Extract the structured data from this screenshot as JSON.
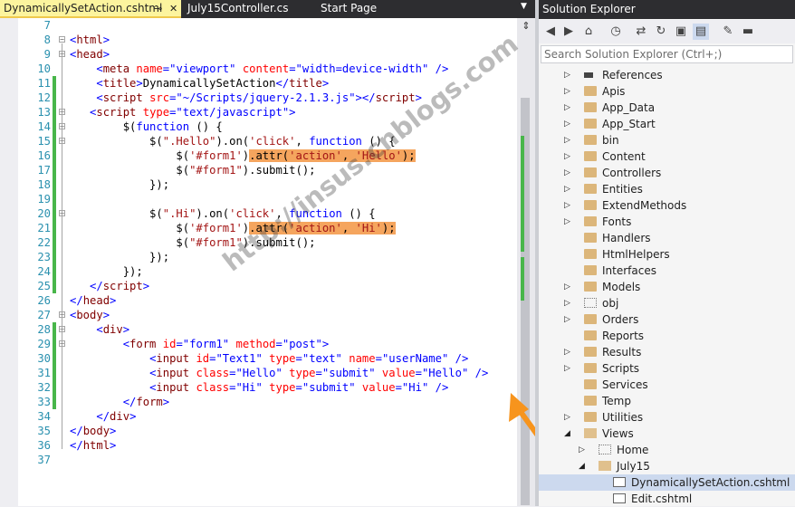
{
  "tabs": [
    {
      "label": "DynamicallySetAction.cshtml",
      "active": true
    },
    {
      "label": "July15Controller.cs",
      "active": false
    },
    {
      "label": "Start Page",
      "active": false
    }
  ],
  "icons": {
    "pin": "pin-icon",
    "close": "close-icon",
    "dropdown": "dropdown-icon"
  },
  "code_lines": [
    {
      "n": "7",
      "fold": "",
      "changed": false,
      "html": ""
    },
    {
      "n": "8",
      "fold": "minus",
      "changed": false,
      "html": "<span class='v'>&lt;</span><span class='t'>html</span><span class='v'>&gt;</span>"
    },
    {
      "n": "9",
      "fold": "minus",
      "changed": false,
      "html": "<span class='v'>&lt;</span><span class='t'>head</span><span class='v'>&gt;</span>"
    },
    {
      "n": "10",
      "fold": "",
      "changed": false,
      "html": "    <span class='v'>&lt;</span><span class='t'>meta</span> <span class='a'>name</span><span class='v'>=\"viewport\"</span> <span class='a'>content</span><span class='v'>=\"width=device-width\"</span> <span class='v'>/&gt;</span>"
    },
    {
      "n": "11",
      "fold": "",
      "changed": true,
      "html": "    <span class='v'>&lt;</span><span class='t'>title</span><span class='v'>&gt;</span>DynamicallySetAction<span class='v'>&lt;/</span><span class='t'>title</span><span class='v'>&gt;</span>"
    },
    {
      "n": "12",
      "fold": "",
      "changed": true,
      "html": "    <span class='v'>&lt;</span><span class='t'>script</span> <span class='a'>src</span><span class='v'>=\"~/Scripts/jquery-2.1.3.js\"</span><span class='v'>&gt;&lt;/</span><span class='t'>script</span><span class='v'>&gt;</span>"
    },
    {
      "n": "13",
      "fold": "minus",
      "changed": true,
      "html": "   <span class='v'>&lt;</span><span class='t'>script</span> <span class='a'>type</span><span class='v'>=\"text/javascript\"</span><span class='v'>&gt;</span>"
    },
    {
      "n": "14",
      "fold": "minus",
      "changed": true,
      "html": "        $(<span class='k'>function</span> () {"
    },
    {
      "n": "15",
      "fold": "minus",
      "changed": true,
      "html": "            $(<span class='s'>\".Hello\"</span>).on(<span class='s'>'click'</span>, <span class='k'>function</span> () {"
    },
    {
      "n": "16",
      "fold": "",
      "changed": true,
      "html": "                $(<span class='s'>'#form1'</span>)<span class='hl'>.attr(<span class='s'>'action'</span>, <span class='s'>'Hello'</span>);</span>"
    },
    {
      "n": "17",
      "fold": "",
      "changed": true,
      "html": "                $(<span class='s'>\"#form1\"</span>).submit();"
    },
    {
      "n": "18",
      "fold": "",
      "changed": true,
      "html": "            });"
    },
    {
      "n": "19",
      "fold": "",
      "changed": true,
      "html": ""
    },
    {
      "n": "20",
      "fold": "minus",
      "changed": true,
      "html": "            $(<span class='s'>\".Hi\"</span>).on(<span class='s'>'click'</span>, <span class='k'>function</span> () {"
    },
    {
      "n": "21",
      "fold": "",
      "changed": true,
      "html": "                $(<span class='s'>'#form1'</span>)<span class='hl'>.attr(<span class='s'>'action'</span>, <span class='s'>'Hi'</span>);</span>"
    },
    {
      "n": "22",
      "fold": "",
      "changed": true,
      "html": "                $(<span class='s'>\"#form1\"</span>).submit();"
    },
    {
      "n": "23",
      "fold": "",
      "changed": true,
      "html": "            });"
    },
    {
      "n": "24",
      "fold": "",
      "changed": true,
      "html": "        });"
    },
    {
      "n": "25",
      "fold": "",
      "changed": true,
      "html": "   <span class='v'>&lt;/</span><span class='t'>script</span><span class='v'>&gt;</span>"
    },
    {
      "n": "26",
      "fold": "",
      "changed": false,
      "html": "<span class='v'>&lt;/</span><span class='t'>head</span><span class='v'>&gt;</span>"
    },
    {
      "n": "27",
      "fold": "minus",
      "changed": false,
      "html": "<span class='v'>&lt;</span><span class='t'>body</span><span class='v'>&gt;</span>"
    },
    {
      "n": "28",
      "fold": "minus",
      "changed": true,
      "html": "    <span class='v'>&lt;</span><span class='t'>div</span><span class='v'>&gt;</span>"
    },
    {
      "n": "29",
      "fold": "minus",
      "changed": true,
      "html": "        <span class='v'>&lt;</span><span class='t'>form</span> <span class='a'>id</span><span class='v'>=\"form1\"</span> <span class='a'>method</span><span class='v'>=\"post\"</span><span class='v'>&gt;</span>"
    },
    {
      "n": "30",
      "fold": "",
      "changed": true,
      "html": "            <span class='v'>&lt;</span><span class='t'>input</span> <span class='a'>id</span><span class='v'>=\"Text1\"</span> <span class='a'>type</span><span class='v'>=\"text\"</span> <span class='a'>name</span><span class='v'>=\"userName\"</span> <span class='v'>/&gt;</span>"
    },
    {
      "n": "31",
      "fold": "",
      "changed": true,
      "html": "            <span class='v'>&lt;</span><span class='t'>input</span> <span class='a'>class</span><span class='v'>=\"Hello\"</span> <span class='a'>type</span><span class='v'>=\"submit\"</span> <span class='a'>value</span><span class='v'>=\"Hello\"</span> <span class='v'>/&gt;</span>"
    },
    {
      "n": "32",
      "fold": "",
      "changed": true,
      "html": "            <span class='v'>&lt;</span><span class='t'>input</span> <span class='a'>class</span><span class='v'>=\"Hi\"</span> <span class='a'>type</span><span class='v'>=\"submit\"</span> <span class='a'>value</span><span class='v'>=\"Hi\"</span> <span class='v'>/&gt;</span>"
    },
    {
      "n": "33",
      "fold": "",
      "changed": true,
      "html": "        <span class='v'>&lt;/</span><span class='t'>form</span><span class='v'>&gt;</span>"
    },
    {
      "n": "34",
      "fold": "",
      "changed": false,
      "html": "    <span class='v'>&lt;/</span><span class='t'>div</span><span class='v'>&gt;</span>"
    },
    {
      "n": "35",
      "fold": "",
      "changed": false,
      "html": "<span class='v'>&lt;/</span><span class='t'>body</span><span class='v'>&gt;</span>"
    },
    {
      "n": "36",
      "fold": "",
      "changed": false,
      "html": "<span class='v'>&lt;/</span><span class='t'>html</span><span class='v'>&gt;</span>"
    },
    {
      "n": "37",
      "fold": "",
      "changed": false,
      "html": ""
    }
  ],
  "watermark": "http://insus.cnblogs.com",
  "solution_explorer": {
    "title": "Solution Explorer",
    "search_placeholder": "Search Solution Explorer (Ctrl+;)",
    "toolbar_icons": [
      "back-icon",
      "forward-icon",
      "home-icon",
      "history-icon",
      "sync-icon",
      "refresh-icon",
      "collapse-all-icon",
      "show-all-files-icon",
      "properties-icon",
      "preview-icon"
    ],
    "items": [
      {
        "label": "References",
        "icon": "references",
        "expand": "right",
        "indent": 0
      },
      {
        "label": "Apis",
        "icon": "folder",
        "expand": "right",
        "indent": 0
      },
      {
        "label": "App_Data",
        "icon": "folder",
        "expand": "right",
        "indent": 0
      },
      {
        "label": "App_Start",
        "icon": "folder",
        "expand": "right",
        "indent": 0
      },
      {
        "label": "bin",
        "icon": "folder",
        "expand": "right",
        "indent": 0
      },
      {
        "label": "Content",
        "icon": "folder",
        "expand": "right",
        "indent": 0
      },
      {
        "label": "Controllers",
        "icon": "folder",
        "expand": "right",
        "indent": 0
      },
      {
        "label": "Entities",
        "icon": "folder",
        "expand": "right",
        "indent": 0
      },
      {
        "label": "ExtendMethods",
        "icon": "folder",
        "expand": "right",
        "indent": 0
      },
      {
        "label": "Fonts",
        "icon": "folder",
        "expand": "right",
        "indent": 0
      },
      {
        "label": "Handlers",
        "icon": "folder",
        "expand": "",
        "indent": 0
      },
      {
        "label": "HtmlHelpers",
        "icon": "folder",
        "expand": "",
        "indent": 0
      },
      {
        "label": "Interfaces",
        "icon": "folder",
        "expand": "",
        "indent": 0
      },
      {
        "label": "Models",
        "icon": "folder",
        "expand": "right",
        "indent": 0
      },
      {
        "label": "obj",
        "icon": "folder-dash",
        "expand": "right",
        "indent": 0
      },
      {
        "label": "Orders",
        "icon": "folder",
        "expand": "right",
        "indent": 0
      },
      {
        "label": "Reports",
        "icon": "folder",
        "expand": "",
        "indent": 0
      },
      {
        "label": "Results",
        "icon": "folder",
        "expand": "right",
        "indent": 0
      },
      {
        "label": "Scripts",
        "icon": "folder",
        "expand": "right",
        "indent": 0
      },
      {
        "label": "Services",
        "icon": "folder",
        "expand": "",
        "indent": 0
      },
      {
        "label": "Temp",
        "icon": "folder",
        "expand": "",
        "indent": 0
      },
      {
        "label": "Utilities",
        "icon": "folder",
        "expand": "right",
        "indent": 0
      },
      {
        "label": "Views",
        "icon": "folder-open",
        "expand": "down",
        "indent": 0
      },
      {
        "label": "Home",
        "icon": "folder-dash",
        "expand": "right",
        "indent": 1
      },
      {
        "label": "July15",
        "icon": "folder-open",
        "expand": "down",
        "indent": 1
      },
      {
        "label": "DynamicallySetAction.cshtml",
        "icon": "cshtml",
        "expand": "",
        "indent": 2,
        "selected": true
      },
      {
        "label": "Edit.cshtml",
        "icon": "cshtml",
        "expand": "",
        "indent": 2
      }
    ]
  },
  "colors": {
    "accent_tab": "#fcf49e",
    "highlight": "#f5a55e",
    "change_bar": "#48b64a",
    "arrow": "#f7941d"
  }
}
